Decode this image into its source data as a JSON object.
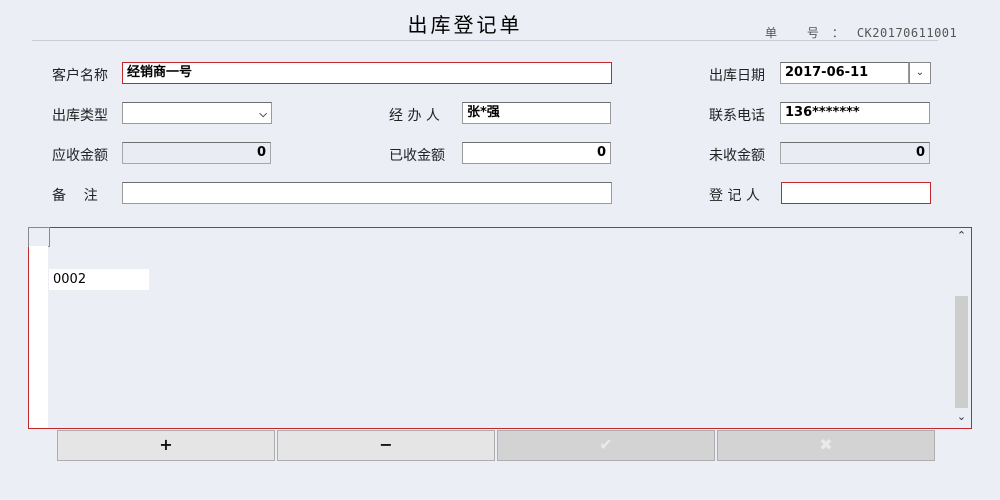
{
  "title": "出库登记单",
  "bill_no": {
    "label": "单 号：",
    "value": "CK20170611001"
  },
  "form": {
    "customer": {
      "label": "客户名称",
      "value": "经销商一号"
    },
    "out_date": {
      "label": "出库日期",
      "value": "2017-06-11"
    },
    "out_type": {
      "label": "出库类型",
      "value": "",
      "options_visible": []
    },
    "handler": {
      "label": "经 办 人",
      "value": "张*强"
    },
    "phone": {
      "label": "联系电话",
      "value": "136*******"
    },
    "receivable": {
      "label": "应收金额",
      "value": "0"
    },
    "received": {
      "label": "已收金额",
      "value": "0"
    },
    "unreceived": {
      "label": "未收金额",
      "value": "0"
    },
    "remark": {
      "label": "备    注",
      "value": ""
    },
    "registrar": {
      "label": "登 记 人",
      "value": ""
    }
  },
  "grid": {
    "rows": [
      {
        "code": "0002"
      }
    ]
  },
  "icons": {
    "select_arrow": "chevron-down-icon",
    "date_dropdown": "date-dropdown-icon",
    "scroll_up": "scroll-up-icon",
    "scroll_down": "scroll-down-icon"
  },
  "buttons": {
    "add": "+",
    "remove": "−",
    "confirm": "✔",
    "cancel": "✖"
  },
  "colors": {
    "background": "#ebeef5",
    "required_border": "#c1272d"
  }
}
